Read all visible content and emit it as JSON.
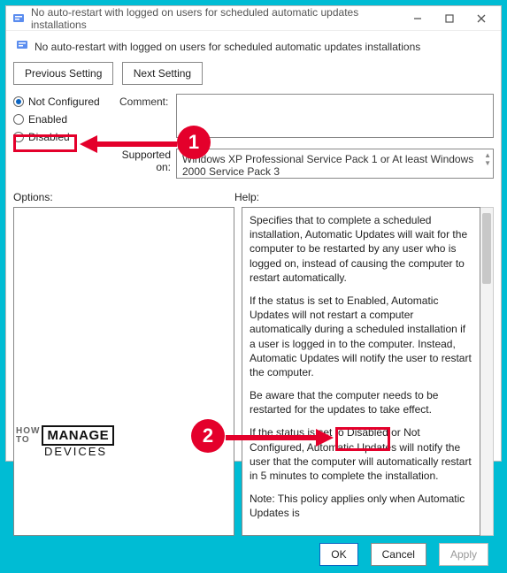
{
  "titlebar": {
    "text": "No auto-restart with logged on users for scheduled automatic updates installations"
  },
  "subheader": {
    "text": "No auto-restart with logged on users for scheduled automatic updates installations"
  },
  "nav": {
    "prev": "Previous Setting",
    "next": "Next Setting"
  },
  "state": {
    "not_configured": "Not Configured",
    "enabled": "Enabled",
    "disabled": "Disabled"
  },
  "labels": {
    "comment": "Comment:",
    "supported": "Supported on:",
    "options": "Options:",
    "help": "Help:"
  },
  "supported": {
    "text": "Windows XP Professional Service Pack 1 or At least Windows 2000 Service Pack 3"
  },
  "help": {
    "p1": "Specifies that to complete a scheduled installation, Automatic Updates will wait for the computer to be restarted by any user who is logged on, instead of causing the computer to restart automatically.",
    "p2": "If the status is set to Enabled, Automatic Updates will not restart a computer automatically during a scheduled installation if a user is logged in to the computer. Instead, Automatic Updates will notify the user to restart the computer.",
    "p3": "Be aware that the computer needs to be restarted for the updates to take effect.",
    "p4": "If the status is set to Disabled or Not Configured, Automatic Updates will notify the user that the computer will automatically restart in 5 minutes to complete the installation.",
    "p5": "Note: This policy applies only when Automatic Updates is"
  },
  "footer": {
    "ok": "OK",
    "cancel": "Cancel",
    "apply": "Apply"
  },
  "annotations": {
    "n1": "1",
    "n2": "2"
  },
  "watermark": {
    "how": "HOW",
    "to": "TO",
    "manage": "MANAGE",
    "devices": "DEVICES"
  }
}
